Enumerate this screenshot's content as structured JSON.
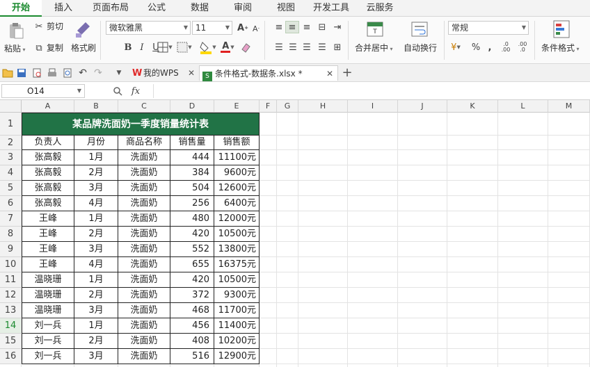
{
  "menu": {
    "tabs": [
      "开始",
      "插入",
      "页面布局",
      "公式",
      "数据",
      "审阅",
      "视图",
      "开发工具",
      "云服务"
    ],
    "active": "开始"
  },
  "ribbon": {
    "paste": "粘贴",
    "cut": "剪切",
    "copy": "复制",
    "format_painter": "格式刷",
    "font_name": "微软雅黑",
    "font_size": "11",
    "merge_center": "合并居中",
    "wrap_text": "自动换行",
    "number_format": "常规",
    "conditional_format": "条件格式",
    "bold": "B",
    "italic": "I",
    "underline": "U",
    "increase_font": "A",
    "decrease_font": "A",
    "percent": "%",
    "thousands": ",",
    "dec_inc": ".0 .00",
    "dec_dec": ".00 .0",
    "currency": "¥",
    "font_color": "A"
  },
  "tabs": {
    "home": "我的WPS",
    "file": "条件格式-数据条.xlsx *"
  },
  "formula_bar": {
    "name_box": "O14",
    "fx": "fx",
    "content": ""
  },
  "sheet": {
    "columns": [
      "A",
      "B",
      "C",
      "D",
      "E",
      "F",
      "G",
      "H",
      "I",
      "J",
      "K",
      "L",
      "M"
    ],
    "rows": [
      "1",
      "2",
      "3",
      "4",
      "5",
      "6",
      "7",
      "8",
      "9",
      "10",
      "11",
      "12",
      "13",
      "14",
      "15",
      "16"
    ],
    "selected_row": "14",
    "title": "某品牌洗面奶一季度销量统计表",
    "title_bg": "#217346",
    "title_color": "#ffffff",
    "headers": [
      "负责人",
      "月份",
      "商品名称",
      "销售量",
      "销售额"
    ],
    "data": [
      [
        "张高毅",
        "1月",
        "洗面奶",
        "444",
        "11100元"
      ],
      [
        "张高毅",
        "2月",
        "洗面奶",
        "384",
        "9600元"
      ],
      [
        "张高毅",
        "3月",
        "洗面奶",
        "504",
        "12600元"
      ],
      [
        "张高毅",
        "4月",
        "洗面奶",
        "256",
        "6400元"
      ],
      [
        "王峰",
        "1月",
        "洗面奶",
        "480",
        "12000元"
      ],
      [
        "王峰",
        "2月",
        "洗面奶",
        "420",
        "10500元"
      ],
      [
        "王峰",
        "3月",
        "洗面奶",
        "552",
        "13800元"
      ],
      [
        "王峰",
        "4月",
        "洗面奶",
        "655",
        "16375元"
      ],
      [
        "温晓珊",
        "1月",
        "洗面奶",
        "420",
        "10500元"
      ],
      [
        "温晓珊",
        "2月",
        "洗面奶",
        "372",
        "9300元"
      ],
      [
        "温晓珊",
        "3月",
        "洗面奶",
        "468",
        "11700元"
      ],
      [
        "刘一兵",
        "1月",
        "洗面奶",
        "456",
        "11400元"
      ],
      [
        "刘一兵",
        "2月",
        "洗面奶",
        "408",
        "10200元"
      ],
      [
        "刘一兵",
        "3月",
        "洗面奶",
        "516",
        "12900元"
      ]
    ]
  },
  "colors": {
    "accent": "#1a8a2e",
    "wps_logo": "#e02a2a",
    "file_icon": "#2f8a3f"
  }
}
